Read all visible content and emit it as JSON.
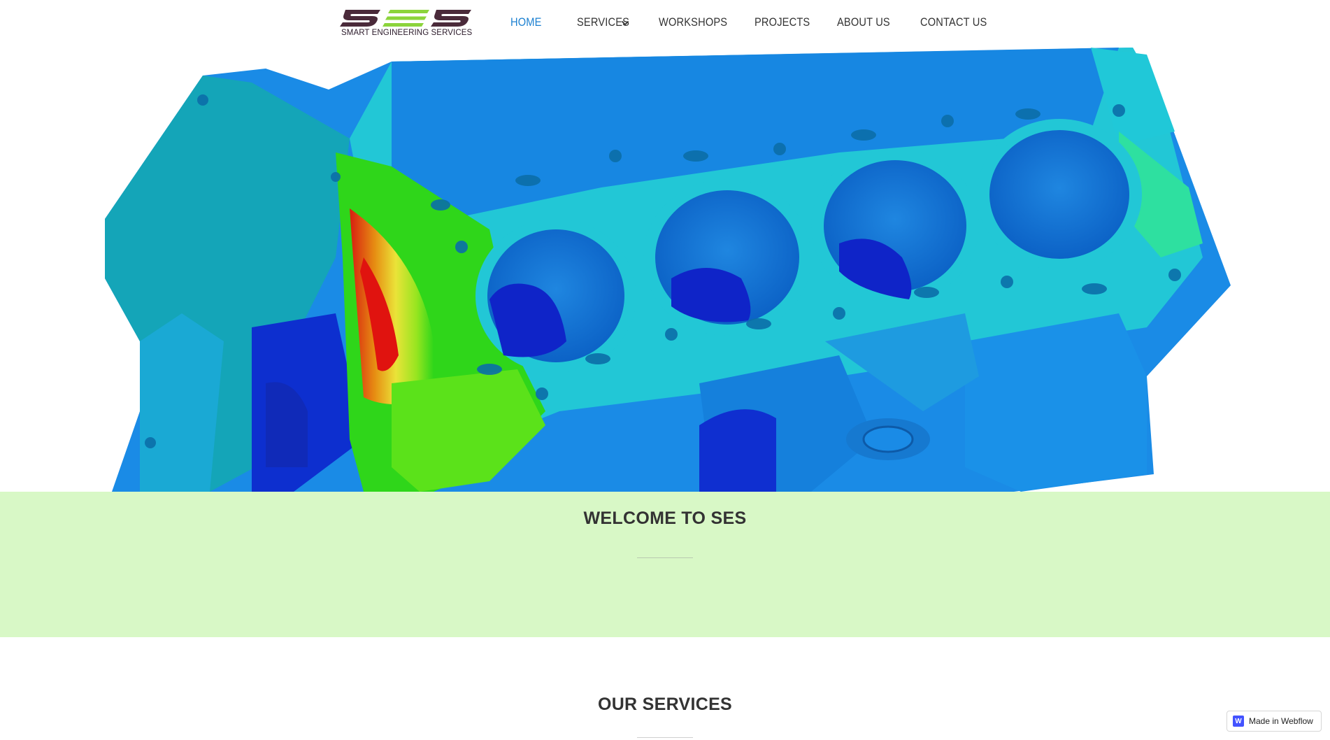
{
  "brand": {
    "logo_mark": "SES",
    "logo_subtitle": "SMART ENGINEERING SERVICES",
    "colors": {
      "dark": "#4a2a3a",
      "green": "#8cd43c"
    }
  },
  "nav": {
    "items": [
      {
        "label": "HOME",
        "active": true
      },
      {
        "label": "SERVICES",
        "has_dropdown": true,
        "icon": "chevron-down-icon"
      },
      {
        "label": "WORKSHOPS"
      },
      {
        "label": "PROJECTS"
      },
      {
        "label": "ABOUT US"
      },
      {
        "label": "CONTACT US"
      }
    ],
    "active_color": "#1a7fd0"
  },
  "hero": {
    "image": "engine-block-fea-stress-simulation"
  },
  "welcome": {
    "title": "WELCOME TO SES",
    "background": "#d8f8c6"
  },
  "services": {
    "title": "OUR SERVICES"
  },
  "badge": {
    "icon": "webflow-icon",
    "icon_letter": "W",
    "label": "Made in Webflow"
  }
}
